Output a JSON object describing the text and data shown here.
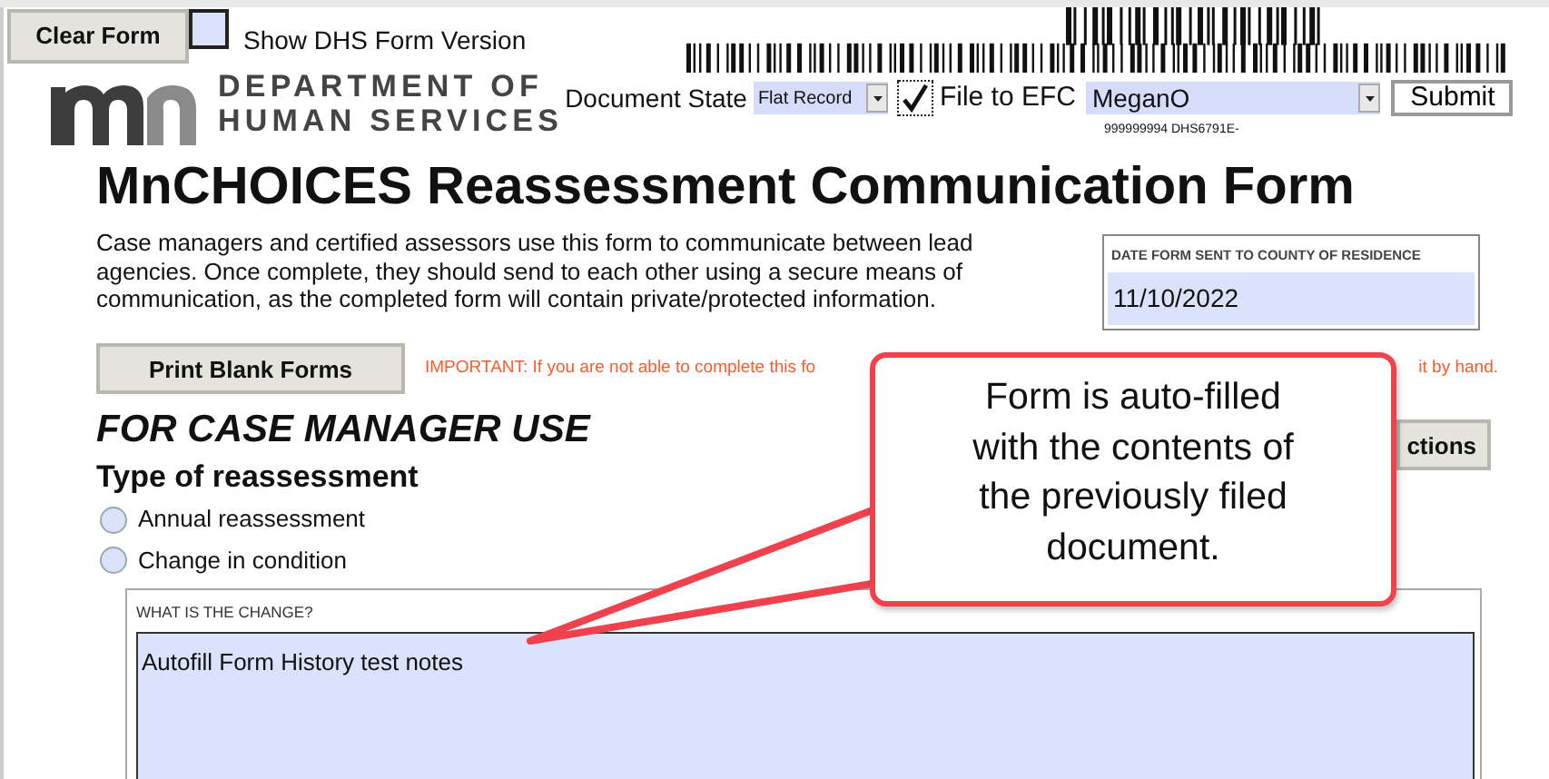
{
  "toolbar": {
    "clear_button": "Clear Form",
    "show_dhs_version": {
      "label": "Show DHS Form Version",
      "checked": false
    }
  },
  "header": {
    "logo_line_1": "DEPARTMENT OF",
    "logo_line_2": "HUMAN SERVICES",
    "document_state_label": "Document State",
    "document_state_value": "Flat Record",
    "file_to_efc": {
      "label": "File to EFC",
      "checked": true
    },
    "efc_user": "MeganO",
    "submit_button": "Submit",
    "barcode_text": "999999994 DHS6791E-"
  },
  "title": "MnCHOICES Reassessment Communication Form",
  "intro": "Case managers and certified assessors use this form to communicate between lead agencies. Once complete, they should send to each other using a secure means of communication, as the completed form will contain private/protected information.",
  "date_sent": {
    "label": "DATE FORM SENT TO COUNTY OF RESIDENCE",
    "value": "11/10/2022"
  },
  "print_button": "Print Blank Forms",
  "notice_parts": [
    "IMPORTANT: If you are not able to complete this fo",
    "it by hand."
  ],
  "instructions_button": "ctions",
  "section_title": "FOR CASE MANAGER USE",
  "reassessment": {
    "heading": "Type of reassessment",
    "options": [
      {
        "label": "Annual reassessment",
        "selected": false
      },
      {
        "label": "Change in condition",
        "selected": false
      }
    ]
  },
  "change": {
    "label": "WHAT IS THE CHANGE?",
    "value": "Autofill Form History test notes"
  },
  "callout": "Form is auto-filled with the contents of the previously filed document."
}
